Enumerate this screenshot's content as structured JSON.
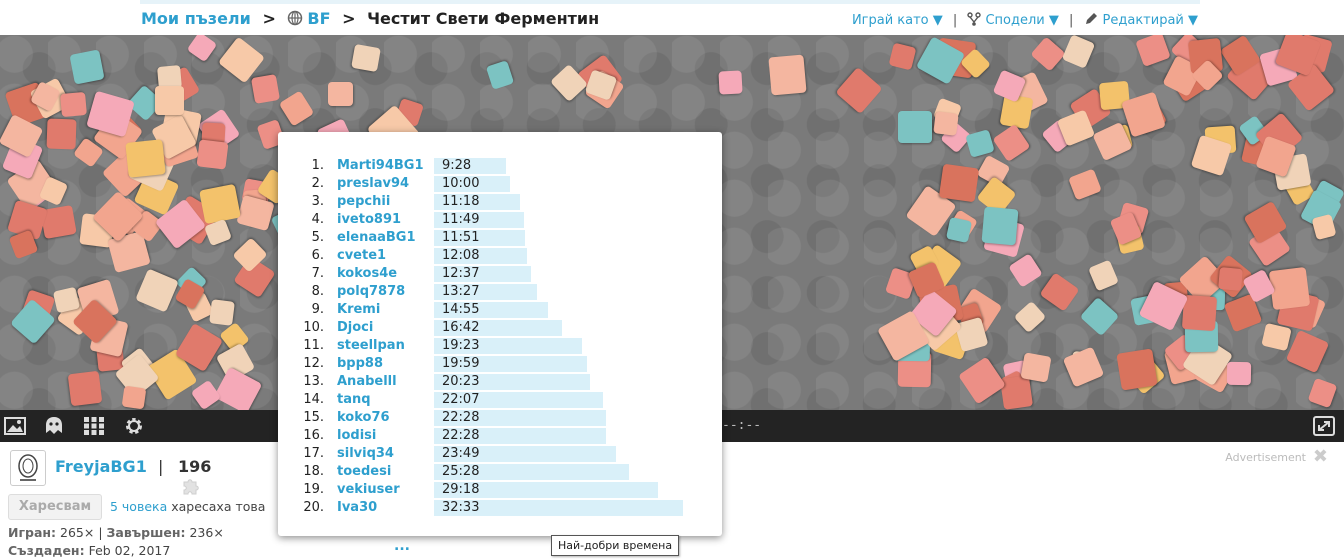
{
  "header": {
    "breadcrumb": {
      "my_puzzles": "Мои пъзели",
      "sep1": ">",
      "category": "BF",
      "sep2": ">",
      "title": "Честит Свети Ферментин"
    },
    "actions": {
      "play_as": "Играй като ▼",
      "share": "Сподели ▼",
      "edit": "Редактирай ▼",
      "pipe": "|"
    }
  },
  "controls": {
    "timer": "--:--"
  },
  "user": {
    "name": "FreyjaBG1",
    "divider": "|",
    "puzzle_count": "196"
  },
  "likes": {
    "button": "Харесвам",
    "count_text": "5 човека",
    "suffix": "харесаха това"
  },
  "stats": {
    "played_label": "Игран:",
    "played_value": "265×",
    "finished_label": "Завършен:",
    "finished_value": "236×",
    "created_label": "Създаден:",
    "created_value": "Feb 02, 2017",
    "sep": "|"
  },
  "ad": {
    "label": "Advertisement"
  },
  "leaderboard": {
    "entries": [
      {
        "rank": "1.",
        "name": "Marti94BG1",
        "time": "9:28",
        "seconds": 568
      },
      {
        "rank": "2.",
        "name": "preslav94",
        "time": "10:00",
        "seconds": 600
      },
      {
        "rank": "3.",
        "name": "pepchii",
        "time": "11:18",
        "seconds": 678
      },
      {
        "rank": "4.",
        "name": "iveto891",
        "time": "11:49",
        "seconds": 709
      },
      {
        "rank": "5.",
        "name": "elenaaBG1",
        "time": "11:51",
        "seconds": 711
      },
      {
        "rank": "6.",
        "name": "cvete1",
        "time": "12:08",
        "seconds": 728
      },
      {
        "rank": "7.",
        "name": "kokos4e",
        "time": "12:37",
        "seconds": 757
      },
      {
        "rank": "8.",
        "name": "polq7878",
        "time": "13:27",
        "seconds": 807
      },
      {
        "rank": "9.",
        "name": "Kremi",
        "time": "14:55",
        "seconds": 895
      },
      {
        "rank": "10.",
        "name": "Djoci",
        "time": "16:42",
        "seconds": 1002
      },
      {
        "rank": "11.",
        "name": "steellpan",
        "time": "19:23",
        "seconds": 1163
      },
      {
        "rank": "12.",
        "name": "bpp88",
        "time": "19:59",
        "seconds": 1199
      },
      {
        "rank": "13.",
        "name": "Anabelll",
        "time": "20:23",
        "seconds": 1223
      },
      {
        "rank": "14.",
        "name": "tanq",
        "time": "22:07",
        "seconds": 1327
      },
      {
        "rank": "15.",
        "name": "koko76",
        "time": "22:28",
        "seconds": 1348
      },
      {
        "rank": "16.",
        "name": "lodisi",
        "time": "22:28",
        "seconds": 1348
      },
      {
        "rank": "17.",
        "name": "silviq34",
        "time": "23:49",
        "seconds": 1429
      },
      {
        "rank": "18.",
        "name": "toedesi",
        "time": "25:28",
        "seconds": 1528
      },
      {
        "rank": "19.",
        "name": "vekiuser",
        "time": "29:18",
        "seconds": 1758
      },
      {
        "rank": "20.",
        "name": "Iva30",
        "time": "32:33",
        "seconds": 1953
      }
    ],
    "more": "...",
    "tooltip": "Най-добри времена"
  },
  "colors": {
    "accent": "#2e9fce",
    "bar": "#d9f0f9",
    "stage": "#7a7a7a",
    "control_bar": "#232323"
  },
  "icons": [
    "globe-icon",
    "share-icon",
    "pencil-icon",
    "image-icon",
    "ghost-icon",
    "grid-icon",
    "gear-icon",
    "fullscreen-icon",
    "puzzle-piece-icon",
    "close-icon"
  ]
}
